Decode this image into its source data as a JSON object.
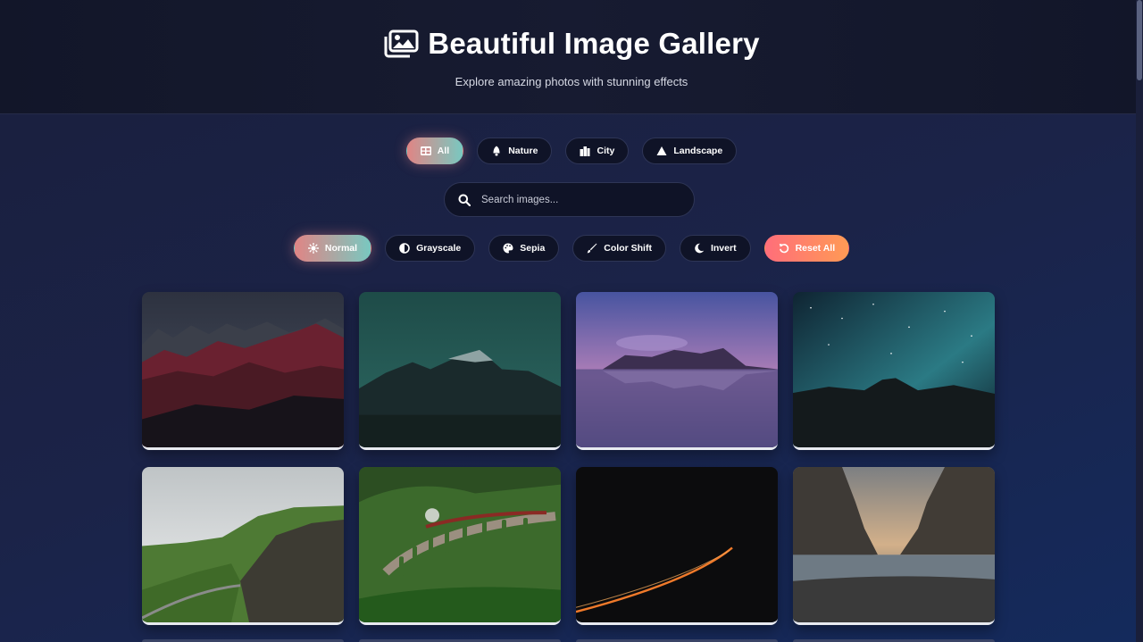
{
  "header": {
    "title": "Beautiful Image Gallery",
    "subtitle": "Explore amazing photos with stunning effects",
    "progress": 0.2
  },
  "categories": [
    {
      "label": "All",
      "icon": "grid-icon",
      "active": true
    },
    {
      "label": "Nature",
      "icon": "leaf-icon",
      "active": false
    },
    {
      "label": "City",
      "icon": "city-icon",
      "active": false
    },
    {
      "label": "Landscape",
      "icon": "mountain-icon",
      "active": false
    }
  ],
  "search": {
    "placeholder": "Search images..."
  },
  "filters": [
    {
      "label": "Normal",
      "icon": "sun-icon",
      "active": true
    },
    {
      "label": "Grayscale",
      "icon": "half-circle-icon",
      "active": false
    },
    {
      "label": "Sepia",
      "icon": "palette-icon",
      "active": false
    },
    {
      "label": "Color Shift",
      "icon": "brush-icon",
      "active": false
    },
    {
      "label": "Invert",
      "icon": "moon-icon",
      "active": false
    },
    {
      "label": "Reset All",
      "icon": "undo-icon",
      "active": false
    }
  ],
  "images": [
    {
      "subject": "red-mountains"
    },
    {
      "subject": "teal-peak-night"
    },
    {
      "subject": "purple-sunset-reflection"
    },
    {
      "subject": "starry-night-cliff"
    },
    {
      "subject": "green-cliffs-road"
    },
    {
      "subject": "viaduct-steam-train"
    },
    {
      "subject": "light-trail-dark"
    },
    {
      "subject": "sea-rocks-sunset"
    }
  ],
  "colors": {
    "accent_gradient_start": "#e08585",
    "accent_gradient_end": "#79c8c0",
    "reset_gradient_start": "#ff6e7a",
    "reset_gradient_end": "#ff9a55",
    "pill_bg": "#0f1327"
  }
}
